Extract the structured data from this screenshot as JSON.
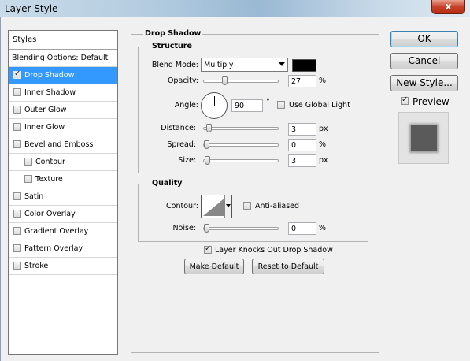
{
  "window": {
    "title": "Layer Style",
    "close_label": "x"
  },
  "sidebar": {
    "header": "Styles",
    "items": [
      {
        "label": "Blending Options: Default",
        "checkbox": false,
        "checked": false,
        "selected": false,
        "indent": 0
      },
      {
        "label": "Drop Shadow",
        "checkbox": true,
        "checked": true,
        "selected": true,
        "indent": 0
      },
      {
        "label": "Inner Shadow",
        "checkbox": true,
        "checked": false,
        "selected": false,
        "indent": 0
      },
      {
        "label": "Outer Glow",
        "checkbox": true,
        "checked": false,
        "selected": false,
        "indent": 0
      },
      {
        "label": "Inner Glow",
        "checkbox": true,
        "checked": false,
        "selected": false,
        "indent": 0
      },
      {
        "label": "Bevel and Emboss",
        "checkbox": true,
        "checked": false,
        "selected": false,
        "indent": 0
      },
      {
        "label": "Contour",
        "checkbox": true,
        "checked": false,
        "selected": false,
        "indent": 1
      },
      {
        "label": "Texture",
        "checkbox": true,
        "checked": false,
        "selected": false,
        "indent": 1
      },
      {
        "label": "Satin",
        "checkbox": true,
        "checked": false,
        "selected": false,
        "indent": 0
      },
      {
        "label": "Color Overlay",
        "checkbox": true,
        "checked": false,
        "selected": false,
        "indent": 0
      },
      {
        "label": "Gradient Overlay",
        "checkbox": true,
        "checked": false,
        "selected": false,
        "indent": 0
      },
      {
        "label": "Pattern Overlay",
        "checkbox": true,
        "checked": false,
        "selected": false,
        "indent": 0
      },
      {
        "label": "Stroke",
        "checkbox": true,
        "checked": false,
        "selected": false,
        "indent": 0
      }
    ]
  },
  "drop_shadow": {
    "title": "Drop Shadow",
    "structure": {
      "title": "Structure",
      "blend_mode_label": "Blend Mode:",
      "blend_mode_value": "Multiply",
      "shadow_color": "#000000",
      "opacity_label": "Opacity:",
      "opacity_value": "27",
      "opacity_unit": "%",
      "angle_label": "Angle:",
      "angle_value": "90",
      "angle_unit": "°",
      "use_global_light_label": "Use Global Light",
      "use_global_light_checked": false,
      "distance_label": "Distance:",
      "distance_value": "3",
      "distance_unit": "px",
      "spread_label": "Spread:",
      "spread_value": "0",
      "spread_unit": "%",
      "size_label": "Size:",
      "size_value": "3",
      "size_unit": "px"
    },
    "quality": {
      "title": "Quality",
      "contour_label": "Contour:",
      "anti_aliased_label": "Anti-aliased",
      "anti_aliased_checked": false,
      "noise_label": "Noise:",
      "noise_value": "0",
      "noise_unit": "%"
    },
    "layer_knocks_out_label": "Layer Knocks Out Drop Shadow",
    "layer_knocks_out_checked": true,
    "make_default_label": "Make Default",
    "reset_default_label": "Reset to Default"
  },
  "actions": {
    "ok_label": "OK",
    "cancel_label": "Cancel",
    "new_style_label": "New Style...",
    "preview_label": "Preview",
    "preview_checked": true
  }
}
